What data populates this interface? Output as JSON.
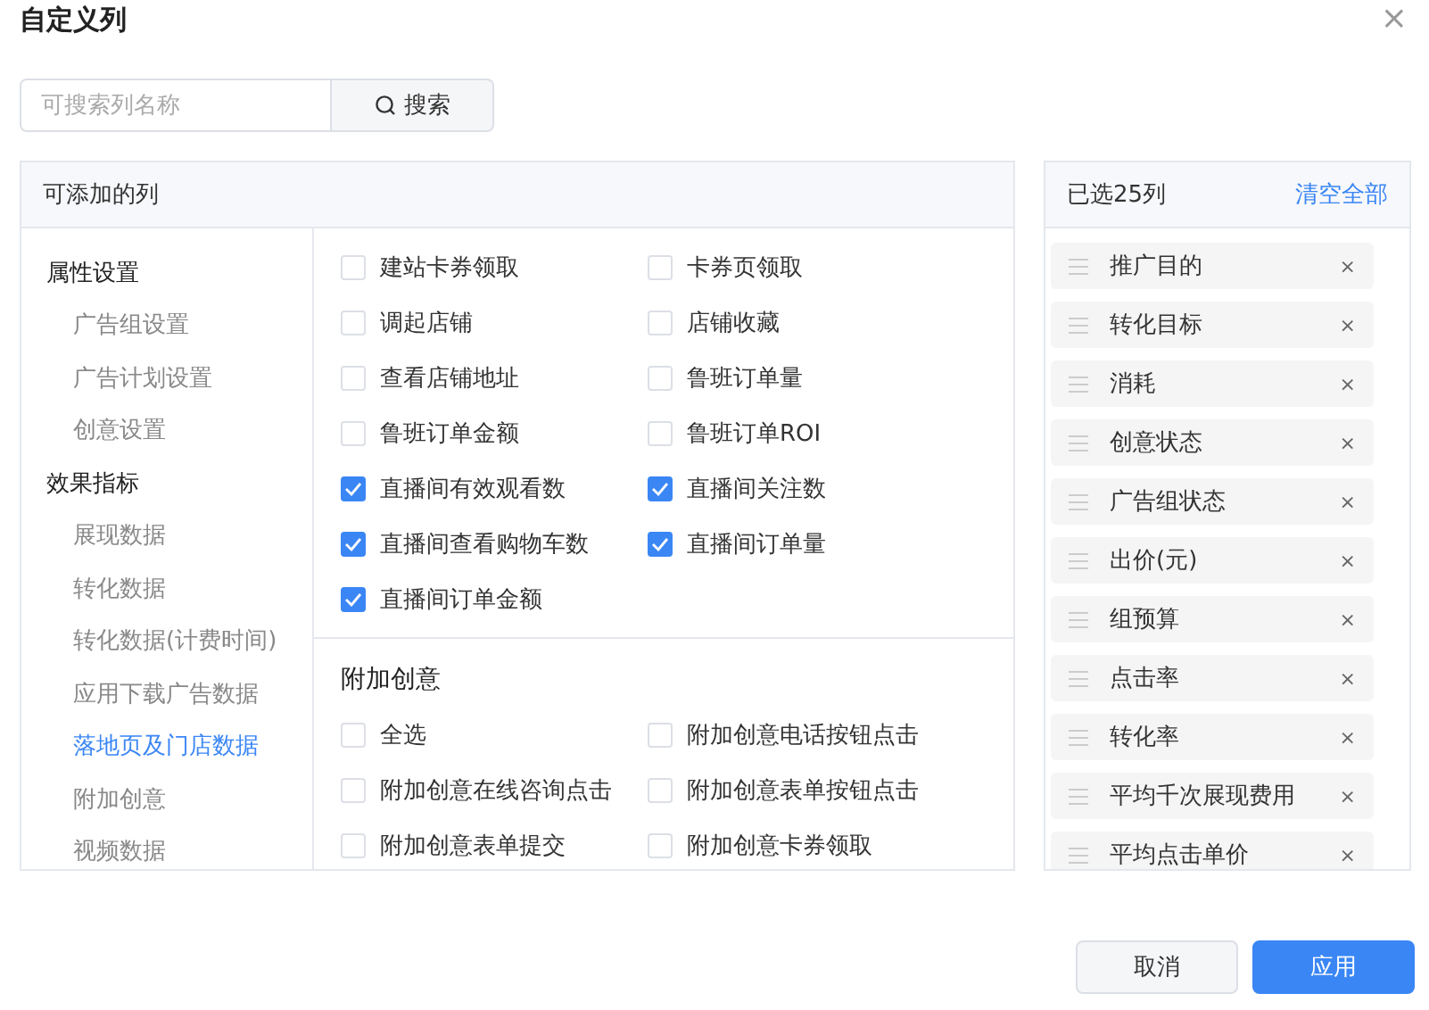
{
  "dialog": {
    "title": "自定义列",
    "close": "×"
  },
  "search": {
    "placeholder": "可搜索列名称",
    "button": "搜索"
  },
  "available": {
    "title": "可添加的列",
    "nav": [
      {
        "label": "属性设置",
        "children": [
          {
            "label": "广告组设置",
            "selected": false
          },
          {
            "label": "广告计划设置",
            "selected": false
          },
          {
            "label": "创意设置",
            "selected": false
          }
        ]
      },
      {
        "label": "效果指标",
        "children": [
          {
            "label": "展现数据",
            "selected": false
          },
          {
            "label": "转化数据",
            "selected": false
          },
          {
            "label": "转化数据(计费时间)",
            "selected": false
          },
          {
            "label": "应用下载广告数据",
            "selected": false
          },
          {
            "label": "落地页及门店数据",
            "selected": true
          },
          {
            "label": "附加创意",
            "selected": false
          },
          {
            "label": "视频数据",
            "selected": false
          }
        ]
      }
    ],
    "sections": [
      {
        "options": [
          {
            "label": "建站卡券领取",
            "checked": false
          },
          {
            "label": "卡券页领取",
            "checked": false
          },
          {
            "label": "调起店铺",
            "checked": false
          },
          {
            "label": "店铺收藏",
            "checked": false
          },
          {
            "label": "查看店铺地址",
            "checked": false
          },
          {
            "label": "鲁班订单量",
            "checked": false
          },
          {
            "label": "鲁班订单金额",
            "checked": false
          },
          {
            "label": "鲁班订单ROI",
            "checked": false
          },
          {
            "label": "直播间有效观看数",
            "checked": true
          },
          {
            "label": "直播间关注数",
            "checked": true
          },
          {
            "label": "直播间查看购物车数",
            "checked": true
          },
          {
            "label": "直播间订单量",
            "checked": true
          },
          {
            "label": "直播间订单金额",
            "checked": true
          }
        ]
      },
      {
        "title": "附加创意",
        "options": [
          {
            "label": "全选",
            "checked": false
          },
          {
            "label": "附加创意电话按钮点击",
            "checked": false
          },
          {
            "label": "附加创意在线咨询点击",
            "checked": false
          },
          {
            "label": "附加创意表单按钮点击",
            "checked": false
          },
          {
            "label": "附加创意表单提交",
            "checked": false
          },
          {
            "label": "附加创意卡券领取",
            "checked": false
          }
        ]
      }
    ]
  },
  "selected": {
    "title": "已选25列",
    "clear": "清空全部",
    "remove": "×",
    "items": [
      "推广目的",
      "转化目标",
      "消耗",
      "创意状态",
      "广告组状态",
      "出价(元)",
      "组预算",
      "点击率",
      "转化率",
      "平均千次展现费用",
      "平均点击单价"
    ]
  },
  "buttons": {
    "cancel": "取消",
    "apply": "应用"
  }
}
